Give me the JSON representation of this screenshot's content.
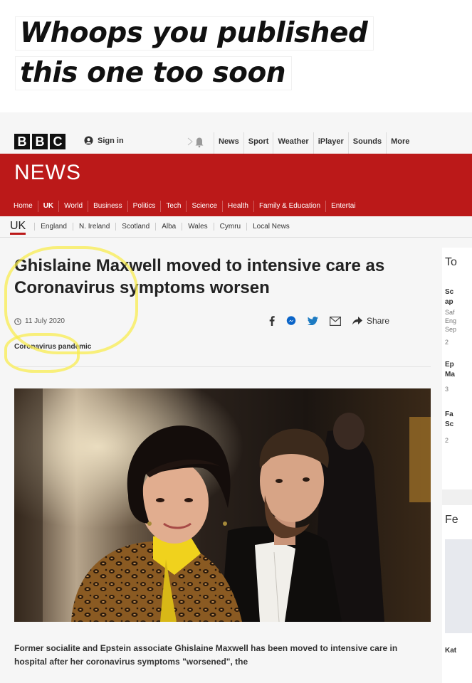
{
  "meme": {
    "line1": "Whoops you published",
    "line2": "this one too soon"
  },
  "header": {
    "logo_letters": [
      "B",
      "B",
      "C"
    ],
    "sign_in": "Sign in",
    "nav": [
      "News",
      "Sport",
      "Weather",
      "iPlayer",
      "Sounds",
      "More"
    ]
  },
  "news_bar": {
    "title": "NEWS",
    "sections": [
      "Home",
      "UK",
      "World",
      "Business",
      "Politics",
      "Tech",
      "Science",
      "Health",
      "Family & Education",
      "Entertai"
    ],
    "active_section": "UK"
  },
  "sub_nav": {
    "title": "UK",
    "items": [
      "England",
      "N. Ireland",
      "Scotland",
      "Alba",
      "Wales",
      "Cymru",
      "Local News"
    ]
  },
  "article": {
    "headline": "Ghislaine Maxwell moved to intensive care as Coronavirus symptoms worsen",
    "date": "11 July 2020",
    "share_label": "Share",
    "tag": "Coronavirus pandemic",
    "body": "Former socialite and Epstein associate Ghislaine Maxwell has been moved to intensive care in hospital after her coronavirus symptoms \"worsened\", the"
  },
  "sidebar": {
    "heading": "To",
    "items": [
      {
        "line1": "Sc",
        "line2": "ap",
        "line3": "Saf",
        "line4": "Eng",
        "line5": "Sep",
        "meta": "2"
      },
      {
        "line1": "Ep",
        "line2": "Ma",
        "meta": "3"
      },
      {
        "line1": "Fa",
        "line2": "Sc",
        "meta": "2"
      }
    ],
    "heading2": "Fe",
    "teaser": "Kat"
  },
  "colors": {
    "bbc_red": "#bb1919",
    "highlight": "#f8ec50"
  }
}
